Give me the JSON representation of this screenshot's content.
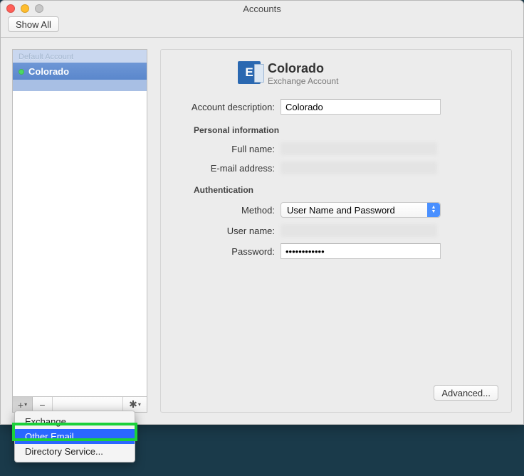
{
  "window": {
    "title": "Accounts",
    "show_all_label": "Show All"
  },
  "sidebar": {
    "section_label": "Default Account",
    "accounts": [
      {
        "name": "Colorado",
        "online": true
      }
    ],
    "add_menu": {
      "items": [
        {
          "label": "Exchange...",
          "selected": false
        },
        {
          "label": "Other Email...",
          "selected": true
        },
        {
          "label": "Directory Service...",
          "selected": false
        }
      ]
    }
  },
  "details": {
    "account_name": "Colorado",
    "account_type": "Exchange Account",
    "labels": {
      "description": "Account description:",
      "personal_info": "Personal information",
      "full_name": "Full name:",
      "email": "E-mail address:",
      "authentication": "Authentication",
      "method": "Method:",
      "user_name": "User name:",
      "password": "Password:"
    },
    "values": {
      "description": "Colorado",
      "method": "User Name and Password",
      "password_mask": "••••••••••••"
    },
    "advanced_label": "Advanced..."
  }
}
